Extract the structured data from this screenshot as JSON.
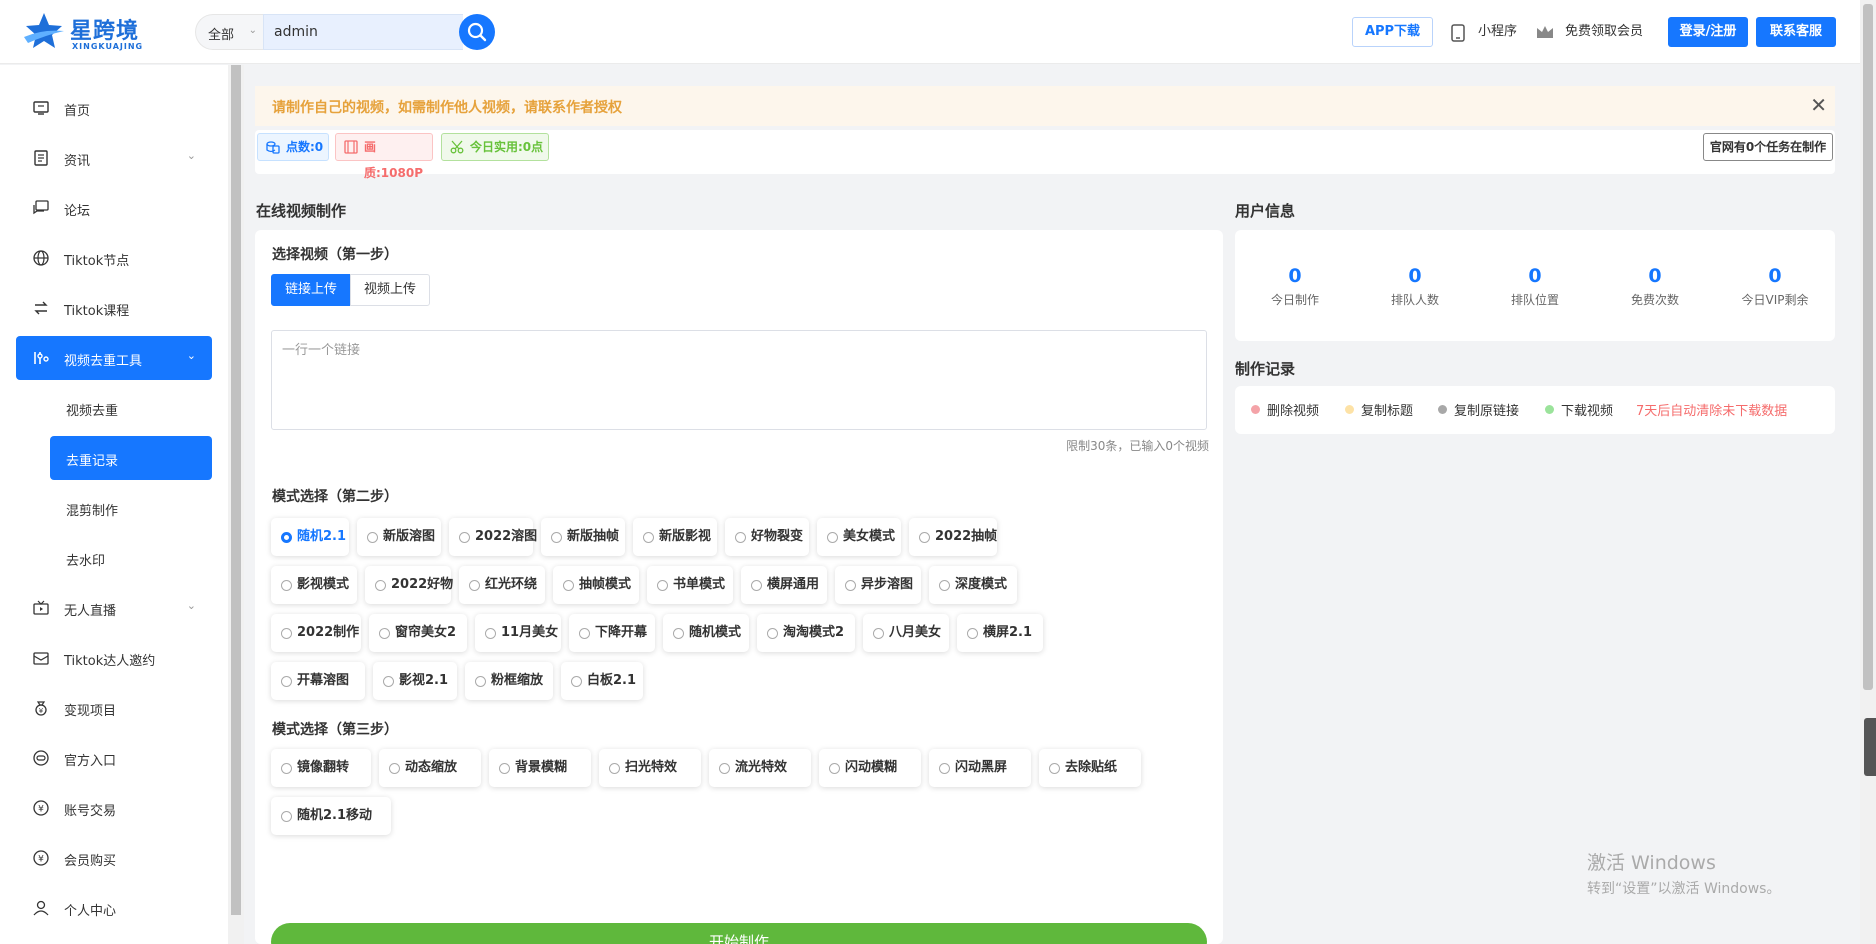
{
  "header": {
    "brand_cn": "星跨境",
    "brand_en": "XINGKUAJING",
    "search_category": "全部",
    "search_value": "admin",
    "app_download": "APP下载",
    "mini_program": "小程序",
    "free_vip": "免费领取会员",
    "login": "登录/注册",
    "service": "联系客服"
  },
  "sidebar": {
    "items": [
      {
        "label": "首页",
        "icon": "monitor-icon"
      },
      {
        "label": "资讯",
        "icon": "document-icon"
      },
      {
        "label": "论坛",
        "icon": "chat-icon"
      },
      {
        "label": "Tiktok节点",
        "icon": "globe-icon"
      },
      {
        "label": "Tiktok课程",
        "icon": "swap-icon"
      },
      {
        "label": "视频去重工具",
        "icon": "tools-icon"
      },
      {
        "label": "无人直播",
        "icon": "tv-icon"
      },
      {
        "label": "Tiktok达人邀约",
        "icon": "mail-icon"
      },
      {
        "label": "变现项目",
        "icon": "money-bag-icon"
      },
      {
        "label": "官方入口",
        "icon": "link-icon"
      },
      {
        "label": "账号交易",
        "icon": "yen-icon"
      },
      {
        "label": "会员购买",
        "icon": "yen-circle-icon"
      },
      {
        "label": "个人中心",
        "icon": "user-icon"
      }
    ],
    "sub_items": [
      "视频去重",
      "去重记录",
      "混剪制作",
      "去水印"
    ]
  },
  "notice": {
    "text": "请制作自己的视频，如需制作他人视频，请联系作者授权"
  },
  "stats_bar": {
    "points": "点数:0",
    "quality": "画质:1080P",
    "today_used": "今日实用:0点",
    "tasks": "官网有0个任务在制作"
  },
  "maker": {
    "title": "在线视频制作",
    "step1": "选择视频（第一步）",
    "tab_link": "链接上传",
    "tab_video": "视频上传",
    "textarea_placeholder": "一行一个链接",
    "limit_hint": "限制30条，已输入0个视频",
    "step2": "模式选择（第二步）",
    "modes": [
      "随机2.1",
      "新版溶图",
      "2022溶图",
      "新版抽帧",
      "新版影视",
      "好物裂变",
      "美女模式",
      "2022抽帧",
      "影视模式",
      "2022好物",
      "红光环绕",
      "抽帧模式",
      "书单模式",
      "横屏通用",
      "异步溶图",
      "深度模式",
      "2022制作",
      "窗帘美女2",
      "11月美女",
      "下降开幕",
      "随机模式",
      "淘淘模式2",
      "八月美女",
      "横屏2.1",
      "开幕溶图",
      "影视2.1",
      "粉框缩放",
      "白板2.1"
    ],
    "selected_mode": "随机2.1",
    "step3": "模式选择（第三步）",
    "effects": [
      "镜像翻转",
      "动态缩放",
      "背景模糊",
      "扫光特效",
      "流光特效",
      "闪动模糊",
      "闪动黑屏",
      "去除贴纸",
      "随机2.1移动"
    ],
    "start": "开始制作"
  },
  "user_info": {
    "title": "用户信息",
    "stats": [
      {
        "value": "0",
        "label": "今日制作"
      },
      {
        "value": "0",
        "label": "排队人数"
      },
      {
        "value": "0",
        "label": "排队位置"
      },
      {
        "value": "0",
        "label": "免费次数"
      },
      {
        "value": "0",
        "label": "今日VIP剩余"
      }
    ]
  },
  "records": {
    "title": "制作记录",
    "legend": [
      {
        "label": "删除视频",
        "color": "#f4a3a8"
      },
      {
        "label": "复制标题",
        "color": "#fde2a6"
      },
      {
        "label": "复制原链接",
        "color": "#a8a8a8"
      },
      {
        "label": "下载视频",
        "color": "#9be39b"
      }
    ],
    "warning": "7天后自动清除未下载数据"
  },
  "watermark": {
    "line1": "激活 Windows",
    "line2": "转到“设置”以激活 Windows。"
  },
  "colors": {
    "primary": "#1677ff",
    "start": "#5fb83c",
    "notice_bg": "#fdf6ec",
    "notice_text": "#e6a23c",
    "warning": "#f56c6c"
  }
}
